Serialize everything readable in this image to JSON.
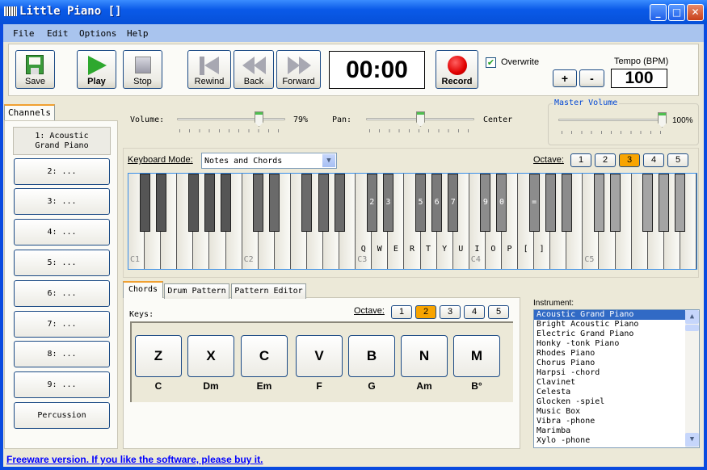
{
  "window": {
    "title": "Little Piano []",
    "controls": [
      "_",
      "□",
      "✕"
    ]
  },
  "menu": [
    "File",
    "Edit",
    "Options",
    "Help"
  ],
  "toolbar": {
    "save": "Save",
    "play": "Play",
    "stop": "Stop",
    "rewind": "Rewind",
    "back": "Back",
    "forward": "Forward",
    "time": "00:00",
    "record": "Record",
    "overwrite_label": "Overwrite",
    "overwrite_checked": true,
    "tempo_label": "Tempo (BPM)",
    "tempo_plus": "+",
    "tempo_minus": "-",
    "tempo": "100"
  },
  "channels": {
    "tab": "Channels",
    "items": [
      "1: Acoustic Grand Piano",
      "2: ...",
      "3: ...",
      "4: ...",
      "5: ...",
      "6: ...",
      "7: ...",
      "8: ...",
      "9: ...",
      "Percussion"
    ],
    "selected": 0
  },
  "mixer": {
    "volume_label": "Volume:",
    "volume": "79%",
    "volume_value": 79,
    "pan_label": "Pan:",
    "pan": "Center",
    "pan_value": 50,
    "master_label": "Master Volume",
    "master": "100%",
    "master_value": 100
  },
  "keyboard": {
    "mode_label": "Keyboard Mode:",
    "mode": "Notes and Chords",
    "octave_label": "Octave:",
    "octaves": [
      "1",
      "2",
      "3",
      "4",
      "5"
    ],
    "octave_selected": "3",
    "octave_labels": [
      "C1",
      "C2",
      "C3",
      "C4",
      "C5"
    ],
    "white_keys_map": {
      "14": "Q",
      "15": "W",
      "16": "E",
      "17": "R",
      "18": "T",
      "19": "Y",
      "20": "U",
      "21": "I",
      "22": "O",
      "23": "P",
      "24": "[",
      "25": "]"
    },
    "black_keys_map": {
      "10": "2",
      "11": "3",
      "12": "5",
      "13": "6",
      "14": "7",
      "15": "9",
      "16": "0",
      "17": "="
    },
    "black_key_colors": [
      "#555555",
      "#6a6a6a",
      "#7a7a7a",
      "#8c8c8c",
      "#a4a4a4"
    ]
  },
  "bottom": {
    "tabs": [
      "Chords",
      "Drum Pattern",
      "Pattern Editor"
    ],
    "keys_label": "Keys:",
    "octave_label": "Octave:",
    "octaves": [
      "1",
      "2",
      "3",
      "4",
      "5"
    ],
    "octave_selected": "2",
    "chords": [
      {
        "key": "Z",
        "name": "C"
      },
      {
        "key": "X",
        "name": "Dm"
      },
      {
        "key": "C",
        "name": "Em"
      },
      {
        "key": "V",
        "name": "F"
      },
      {
        "key": "B",
        "name": "G"
      },
      {
        "key": "N",
        "name": "Am"
      },
      {
        "key": "M",
        "name": "B°"
      }
    ]
  },
  "instrument": {
    "label": "Instrument:",
    "items": [
      "Acoustic Grand Piano",
      "Bright Acoustic Piano",
      "Electric Grand Piano",
      "Honky -tonk Piano",
      "Rhodes Piano",
      "Chorus Piano",
      "Harpsi -chord",
      "Clavinet",
      "Celesta",
      "Glocken -spiel",
      "Music Box",
      "Vibra -phone",
      "Marimba",
      "Xylo -phone"
    ],
    "selected": 0
  },
  "footer": {
    "link": "Freeware version. If you like the software, please buy it."
  },
  "colors": {
    "accent": "#f8a400",
    "link": "#0000ff",
    "title_bar": "#0a5ae8"
  }
}
